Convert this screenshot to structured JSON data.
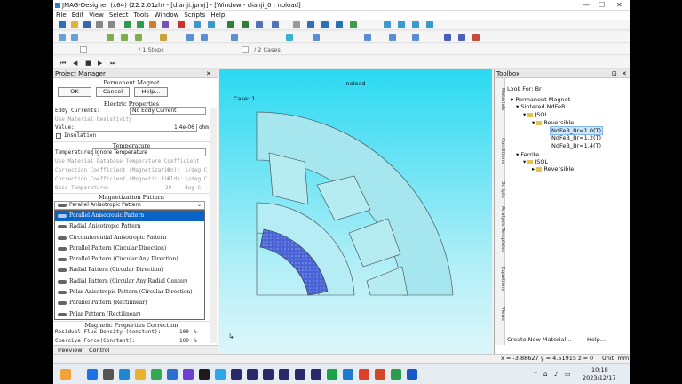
{
  "window": {
    "title": "JMAG-Designer (x64) (22.2.01zh) - [dianji.jproj] - [Window - dianji_0 : noload]",
    "minimize": "—",
    "maximize": "☐",
    "close": "✕"
  },
  "menu": [
    "File",
    "Edit",
    "View",
    "Select",
    "Tools",
    "Window",
    "Scripts",
    "Help"
  ],
  "toolbar": {
    "steps_label": "/ 1 Steps",
    "cases_label": "/ 2 Cases"
  },
  "project_manager": {
    "title": "Project Manager",
    "section_title": "Permanent Magnet",
    "ok": "OK",
    "cancel": "Cancel",
    "help": "Help...",
    "electric_properties": "Electric Properties",
    "eddy_currents_label": "Eddy Currents:",
    "eddy_currents_value": "No Eddy Current",
    "use_material_resistivity": "Use Material Resistivity",
    "value_label": "Value:",
    "value": "1.4e-06",
    "value_unit": "ohm",
    "insulation": "Insulation",
    "temperature": "Temperature",
    "temperature_label": "Temperature:",
    "temperature_value": "Ignore Temperature",
    "use_material_db_temp": "Use Material Database Temperature Coefficient",
    "coef_mag_label": "Correction Coefficient (Magnetization):",
    "coef_mag_value": "0",
    "coef_mag_unit": "1/deg C",
    "coef_field_label": "Correction Coefficient (Magnetic Field):",
    "coef_field_value": "0",
    "coef_field_unit": "1/deg C",
    "base_temp_label": "Base Temperature:",
    "base_temp_value": "20",
    "base_temp_unit": "deg C",
    "magnetization_pattern": "Magnetization Pattern",
    "pattern_selected": "Parallel Anisotropic Pattern",
    "pattern_options": [
      "Parallel Anisotropic Pattern",
      "Radial Anisotropic Pattern",
      "Circumferential Anisotropic Pattern",
      "Parallel Pattern (Circular Direction)",
      "Parallel Pattern (Circular Any Direction)",
      "Radial Pattern (Circular Direction)",
      "Radial Pattern (Circular Any Radial Center)",
      "Polar Anisotropic Pattern (Circular Direction)",
      "Parallel Pattern (Rectilinear)",
      "Polar Pattern (Rectilinear)"
    ],
    "magnetic_properties_correction": "Magnetic Properties Correction",
    "residual_flux_label": "Residual Flux Density (Constant):",
    "residual_flux_value": "100",
    "residual_flux_unit": "%",
    "coercive_force_label": "Coercive Force(Constant):",
    "coercive_force_value": "100",
    "coercive_force_unit": "%",
    "tab_treeview": "Treeview",
    "tab_control": "Control"
  },
  "viewport": {
    "window_label": "noload",
    "case_label": "Case: 1"
  },
  "toolbox": {
    "title": "Toolbox",
    "look_for": "Look For: Br",
    "vertical_tabs": [
      "Materials",
      "Conditions",
      "Scripts",
      "Analysis Templates",
      "Equations",
      "Views"
    ],
    "tree": {
      "root": "Permanent Magnet",
      "sintered": "Sintered NdFeB",
      "jsol1": "JSOL",
      "reversible1": "Reversible",
      "items": [
        "NdFeB_Br=1.0(T)",
        "NdFeB_Br=1.2(T)",
        "NdFeB_Br=1.4(T)"
      ],
      "ferrite": "Ferrite",
      "jsol2": "JSOL",
      "reversible2": "Reversible"
    },
    "create_new": "Create New Material...",
    "help": "Help..."
  },
  "status": {
    "coords": "x = -3.88627  y = 4.51915  z =",
    "z_value": "0",
    "unit": "Unit: mm"
  },
  "taskbar": {
    "time": "10:18",
    "date": "2023/12/17"
  },
  "colors": {
    "accent": "#0a64c8",
    "magnet": "#4a64d6",
    "viewport_top": "#2ad9f2"
  }
}
